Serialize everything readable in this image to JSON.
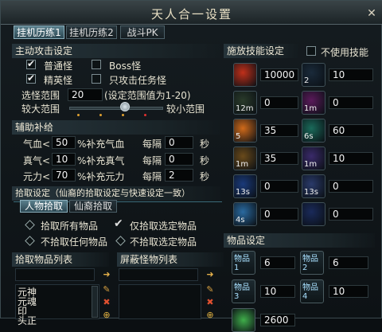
{
  "window": {
    "title": "天人合一设置",
    "close": "✕"
  },
  "tabs": [
    {
      "label": "挂机历练1",
      "active": true
    },
    {
      "label": "挂机历练2",
      "active": false
    },
    {
      "label": "战斗PK",
      "active": false
    }
  ],
  "active_attack": {
    "header": "主动攻击设定",
    "options": [
      {
        "label": "普通怪",
        "checked": true
      },
      {
        "label": "Boss怪",
        "checked": false
      },
      {
        "label": "精英怪",
        "checked": true
      },
      {
        "label": "只攻击任务怪",
        "checked": false
      }
    ],
    "range_label": "选怪范围",
    "range_value": "20",
    "range_hint": "(设定范围值为1-20)",
    "slider_left": "较大范围",
    "slider_right": "较小范围"
  },
  "assist": {
    "header": "辅助补给",
    "rows": [
      {
        "label": "气血<",
        "value": "50",
        "action": "%补充气血",
        "interval_label": "每隔",
        "interval": "0",
        "unit": "秒"
      },
      {
        "label": "真气<",
        "value": "10",
        "action": "%补充真气",
        "interval_label": "每隔",
        "interval": "0",
        "unit": "秒"
      },
      {
        "label": "元力<",
        "value": "70",
        "action": "%补充元力",
        "interval_label": "每隔",
        "interval": "2",
        "unit": "秒"
      }
    ]
  },
  "loot": {
    "header": "拾取设定（仙裔的拾取设定与快速设定一致）",
    "subtabs": [
      {
        "label": "人物拾取",
        "active": true
      },
      {
        "label": "仙裔拾取",
        "active": false
      }
    ],
    "options": [
      {
        "label": "拾取所有物品",
        "selected": false
      },
      {
        "label": "仅拾取选定物品",
        "selected": true
      },
      {
        "label": "不拾取任何物品",
        "selected": false
      },
      {
        "label": "不拾取选定物品",
        "selected": false
      }
    ],
    "pick_list_header": "拾取物品列表",
    "block_list_header": "屏蔽怪物列表",
    "pick_items": [
      "元神",
      "元魂",
      "印",
      "头正"
    ]
  },
  "skills": {
    "header": "施放技能设定",
    "disable_label": "不使用技能",
    "disable_checked": false,
    "slots": [
      {
        "badge": "",
        "value": "10000",
        "color": "#c0301a"
      },
      {
        "badge": "2",
        "value": "10",
        "color": "#1a2a3a"
      },
      {
        "badge": "12m",
        "value": "0",
        "color": "#2a3b2a"
      },
      {
        "badge": "1m",
        "value": "0",
        "color": "#5a1a5a"
      },
      {
        "badge": "5",
        "value": "35",
        "color": "#d06a1a"
      },
      {
        "badge": "6s",
        "value": "60",
        "color": "#1a6a5a"
      },
      {
        "badge": "1m",
        "value": "35",
        "color": "#6a4a1a"
      },
      {
        "badge": "1m",
        "value": "10",
        "color": "#3a2a6a"
      },
      {
        "badge": "13s",
        "value": "0",
        "color": "#1a3a7a"
      },
      {
        "badge": "13s",
        "value": "0",
        "color": "#2a3a6a"
      },
      {
        "badge": "4s",
        "value": "0",
        "color": "#2a6aa0"
      },
      {
        "badge": "",
        "value": "0",
        "color": "#1a2a5a"
      }
    ]
  },
  "items": {
    "header": "物品设定",
    "slots": [
      {
        "label": "物品1",
        "value": "6"
      },
      {
        "label": "物品2",
        "value": "6"
      },
      {
        "label": "物品3",
        "value": "10"
      },
      {
        "label": "物品4",
        "value": "10"
      },
      {
        "label": "",
        "value": "2600"
      }
    ]
  },
  "colors": {
    "accent": "#5a7f8c",
    "panel": "#151c20"
  }
}
